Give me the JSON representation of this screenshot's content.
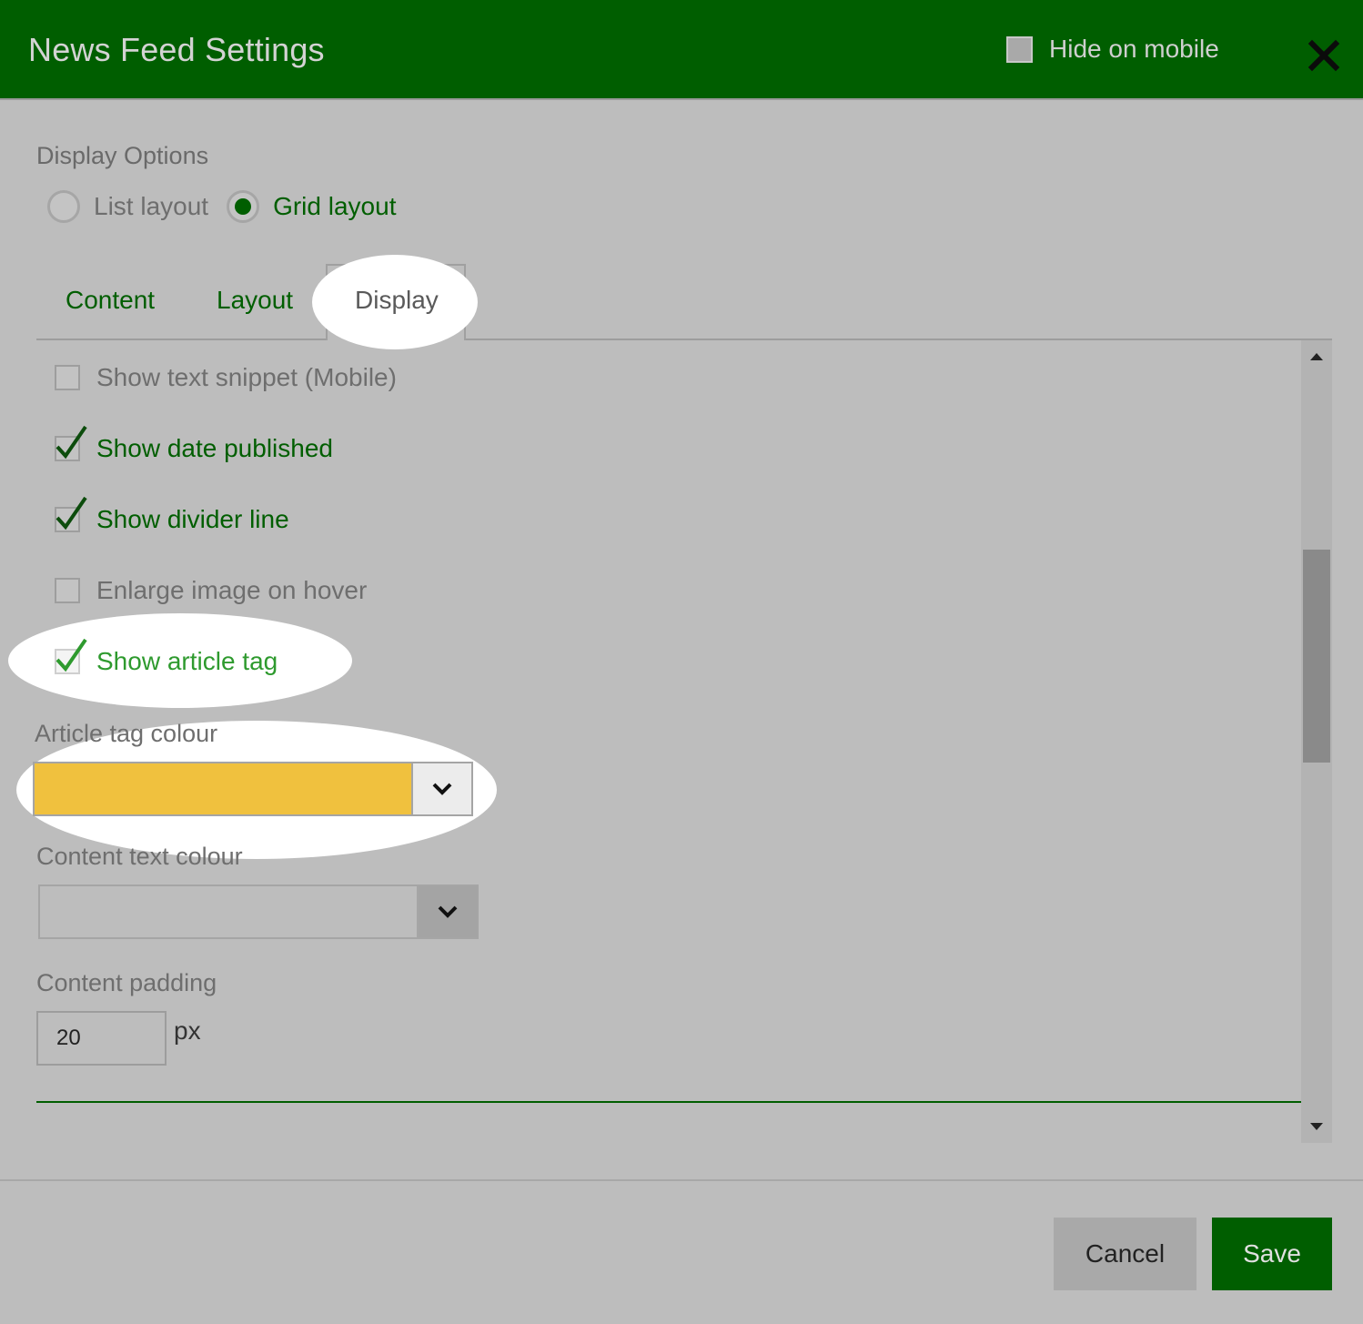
{
  "dialog": {
    "title": "News Feed Settings",
    "hide_on_mobile_label": "Hide on mobile",
    "hide_on_mobile_checked": false,
    "close_icon": "close-icon"
  },
  "display_options": {
    "label": "Display Options",
    "layouts": [
      {
        "label": "List layout",
        "selected": false
      },
      {
        "label": "Grid layout",
        "selected": true
      }
    ]
  },
  "tabs": [
    {
      "label": "Content",
      "active": false
    },
    {
      "label": "Layout",
      "active": false
    },
    {
      "label": "Display",
      "active": true
    }
  ],
  "options": [
    {
      "label": "Show text snippet (Mobile)",
      "checked": false
    },
    {
      "label": "Show date published",
      "checked": true
    },
    {
      "label": "Show divider line",
      "checked": true
    },
    {
      "label": "Enlarge image on hover",
      "checked": false
    },
    {
      "label": "Show article tag",
      "checked": true
    }
  ],
  "article_tag_colour": {
    "label": "Article tag colour",
    "value_color": "#f0c13e"
  },
  "content_text_colour": {
    "label": "Content text colour",
    "value_color": ""
  },
  "content_padding": {
    "label": "Content padding",
    "value": "20",
    "unit": "px"
  },
  "footer": {
    "cancel_label": "Cancel",
    "save_label": "Save"
  },
  "colors": {
    "brand_green": "#005e00",
    "highlight": "#ffffff",
    "check_green": "#2e9a2e"
  }
}
